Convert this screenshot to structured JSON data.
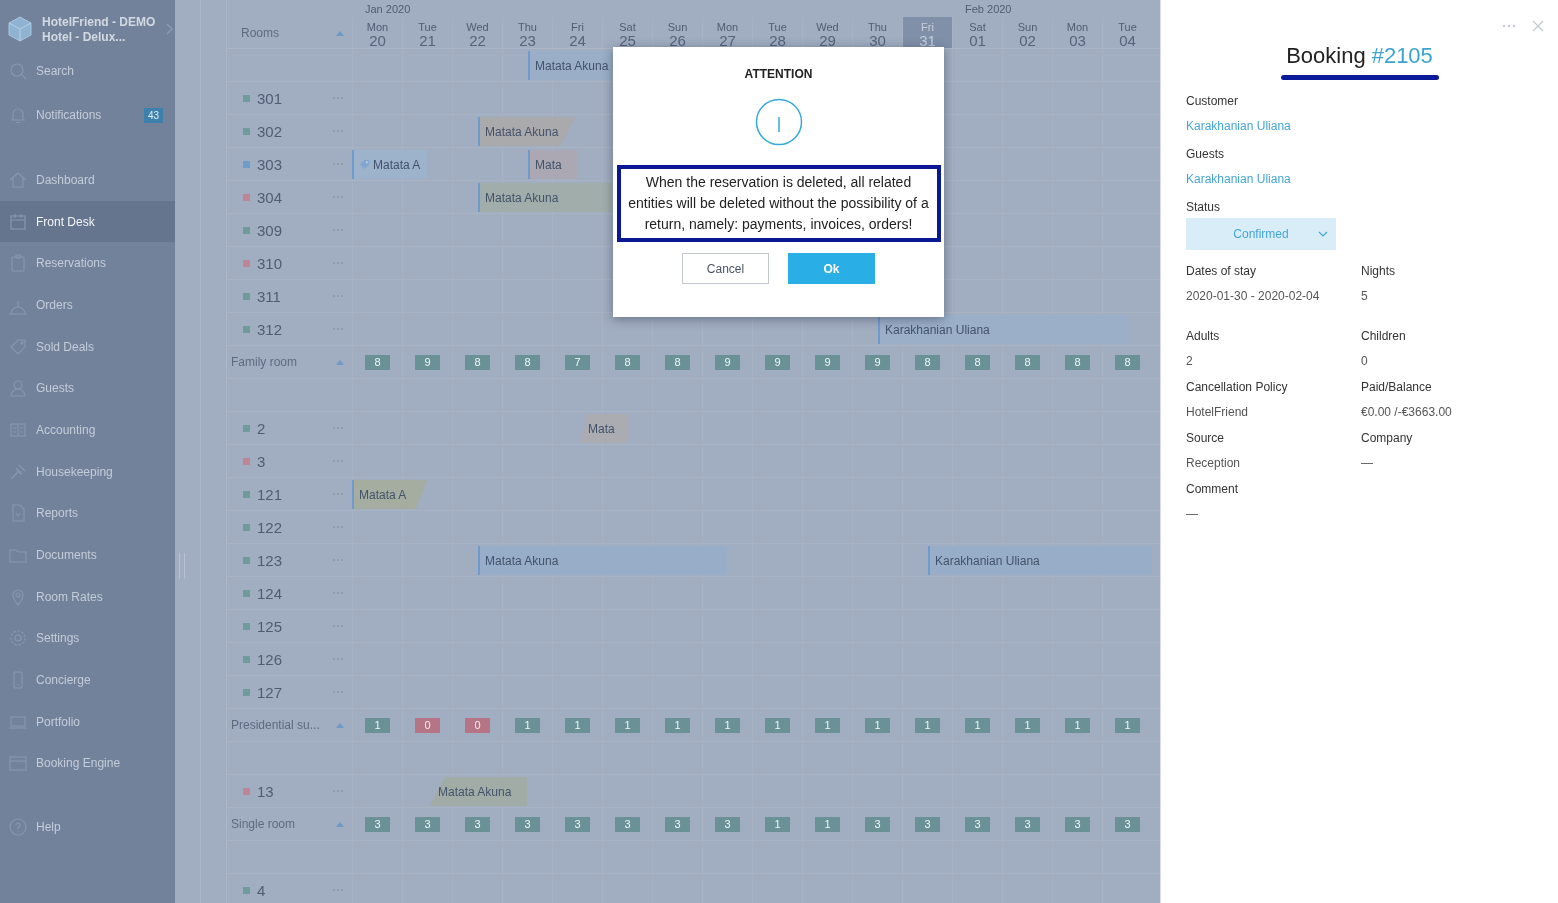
{
  "sidebar": {
    "hotel_name": "HotelFriend - DEMO",
    "hotel_subtitle": "Hotel - Delux...",
    "top_items": [
      {
        "label": "Search",
        "selected": false
      },
      {
        "label": "Notifications",
        "selected": false,
        "badge": "43"
      }
    ],
    "menu_items": [
      {
        "label": "Dashboard",
        "selected": false
      },
      {
        "label": "Front Desk",
        "selected": true
      },
      {
        "label": "Reservations",
        "selected": false
      },
      {
        "label": "Orders",
        "selected": false
      },
      {
        "label": "Sold Deals",
        "selected": false
      },
      {
        "label": "Guests",
        "selected": false
      },
      {
        "label": "Accounting",
        "selected": false
      },
      {
        "label": "Housekeeping",
        "selected": false
      },
      {
        "label": "Reports",
        "selected": false
      },
      {
        "label": "Documents",
        "selected": false
      },
      {
        "label": "Room Rates",
        "selected": false
      },
      {
        "label": "Settings",
        "selected": false
      },
      {
        "label": "Concierge",
        "selected": false
      },
      {
        "label": "Portfolio",
        "selected": false
      },
      {
        "label": "Booking Engine",
        "selected": false
      }
    ],
    "bottom_items": [
      {
        "label": "Help",
        "selected": false
      }
    ]
  },
  "calendar": {
    "rooms_header": "Rooms",
    "months": [
      {
        "label": "Jan 2020"
      },
      {
        "label": "Feb 2020"
      }
    ],
    "days": [
      {
        "name": "Mon",
        "date": "20",
        "today": false
      },
      {
        "name": "Tue",
        "date": "21",
        "today": false
      },
      {
        "name": "Wed",
        "date": "22",
        "today": false
      },
      {
        "name": "Thu",
        "date": "23",
        "today": false
      },
      {
        "name": "Fri",
        "date": "24",
        "today": false
      },
      {
        "name": "Sat",
        "date": "25",
        "today": false
      },
      {
        "name": "Sun",
        "date": "26",
        "today": false
      },
      {
        "name": "Mon",
        "date": "27",
        "today": false
      },
      {
        "name": "Tue",
        "date": "28",
        "today": false
      },
      {
        "name": "Wed",
        "date": "29",
        "today": false
      },
      {
        "name": "Thu",
        "date": "30",
        "today": false
      },
      {
        "name": "Fri",
        "date": "31",
        "today": true
      },
      {
        "name": "Sat",
        "date": "01",
        "today": false
      },
      {
        "name": "Sun",
        "date": "02",
        "today": false
      },
      {
        "name": "Mon",
        "date": "03",
        "today": false
      },
      {
        "name": "Tue",
        "date": "04",
        "today": false
      }
    ],
    "rows": [
      {
        "kind": "unassigned",
        "bookings": [
          {
            "guest": "Matata Akuna",
            "color": "#9aaec7",
            "tagged": false
          }
        ]
      },
      {
        "kind": "room",
        "number": "301",
        "color": "#6d9c9b"
      },
      {
        "kind": "room",
        "number": "302",
        "color": "#6d9c9b",
        "bookings": [
          {
            "guest": "Matata Akuna",
            "color": "#aaa9ab",
            "tagged": false
          }
        ]
      },
      {
        "kind": "room",
        "number": "303",
        "color": "#6f9cc8",
        "bookings": [
          {
            "guest": "Matata A",
            "color": "#9db3cc",
            "tagged": true
          },
          {
            "guest": "Mata",
            "color": "#aba8b3",
            "tagged": false
          }
        ]
      },
      {
        "kind": "room",
        "number": "304",
        "color": "#c08595",
        "bookings": [
          {
            "guest": "Matata Akuna",
            "color": "#a1adab",
            "tagged": false
          }
        ]
      },
      {
        "kind": "room",
        "number": "309",
        "color": "#6d9c9b"
      },
      {
        "kind": "room",
        "number": "310",
        "color": "#c08595"
      },
      {
        "kind": "room",
        "number": "311",
        "color": "#6d9c9b"
      },
      {
        "kind": "room",
        "number": "312",
        "color": "#6d9c9b",
        "bookings": [
          {
            "guest": "Karakhanian Uliana",
            "color": "#9bafc8",
            "tagged": false
          }
        ]
      },
      {
        "kind": "group",
        "name": "Family room",
        "expanded": true,
        "counts": [
          {
            "value": "8",
            "sold_out": false
          },
          {
            "value": "9",
            "sold_out": false
          },
          {
            "value": "8",
            "sold_out": false
          },
          {
            "value": "8",
            "sold_out": false
          },
          {
            "value": "7",
            "sold_out": false
          },
          {
            "value": "8",
            "sold_out": false
          },
          {
            "value": "8",
            "sold_out": false
          },
          {
            "value": "9",
            "sold_out": false
          },
          {
            "value": "9",
            "sold_out": false
          },
          {
            "value": "9",
            "sold_out": false
          },
          {
            "value": "9",
            "sold_out": false
          },
          {
            "value": "8",
            "sold_out": false
          },
          {
            "value": "8",
            "sold_out": false
          },
          {
            "value": "8",
            "sold_out": false
          },
          {
            "value": "8",
            "sold_out": false
          },
          {
            "value": "8",
            "sold_out": false
          }
        ]
      },
      {
        "kind": "spacer"
      },
      {
        "kind": "room",
        "number": "2",
        "color": "#6d9c9b",
        "bookings": [
          {
            "guest": "Mata",
            "color": "#aaacb2",
            "tagged": false
          }
        ]
      },
      {
        "kind": "room",
        "number": "3",
        "color": "#c08595"
      },
      {
        "kind": "room",
        "number": "121",
        "color": "#6d9c9b",
        "bookings": [
          {
            "guest": "Matata A",
            "color": "#a4ada0",
            "tagged": false
          }
        ]
      },
      {
        "kind": "room",
        "number": "122",
        "color": "#6d9c9b"
      },
      {
        "kind": "room",
        "number": "123",
        "color": "#6d9c9b",
        "bookings": [
          {
            "guest": "Matata Akuna",
            "color": "#98adc8",
            "tagged": false
          },
          {
            "guest": "Karakhanian Uliana",
            "color": "#98adc8",
            "tagged": false
          }
        ]
      },
      {
        "kind": "room",
        "number": "124",
        "color": "#6d9c9b"
      },
      {
        "kind": "room",
        "number": "125",
        "color": "#6d9c9b"
      },
      {
        "kind": "room",
        "number": "126",
        "color": "#6d9c9b"
      },
      {
        "kind": "room",
        "number": "127",
        "color": "#6d9c9b"
      },
      {
        "kind": "group",
        "name": "Presidential su...",
        "expanded": true,
        "counts": [
          {
            "value": "1",
            "sold_out": false
          },
          {
            "value": "0",
            "sold_out": true
          },
          {
            "value": "0",
            "sold_out": true
          },
          {
            "value": "1",
            "sold_out": false
          },
          {
            "value": "1",
            "sold_out": false
          },
          {
            "value": "1",
            "sold_out": false
          },
          {
            "value": "1",
            "sold_out": false
          },
          {
            "value": "1",
            "sold_out": false
          },
          {
            "value": "1",
            "sold_out": false
          },
          {
            "value": "1",
            "sold_out": false
          },
          {
            "value": "1",
            "sold_out": false
          },
          {
            "value": "1",
            "sold_out": false
          },
          {
            "value": "1",
            "sold_out": false
          },
          {
            "value": "1",
            "sold_out": false
          },
          {
            "value": "1",
            "sold_out": false
          },
          {
            "value": "1",
            "sold_out": false
          }
        ]
      },
      {
        "kind": "spacer"
      },
      {
        "kind": "room",
        "number": "13",
        "color": "#c08595",
        "bookings": [
          {
            "guest": "Matata Akuna",
            "color": "#a2aca6",
            "tagged": false
          }
        ]
      },
      {
        "kind": "group",
        "name": "Single room",
        "expanded": true,
        "counts": [
          {
            "value": "3",
            "sold_out": false
          },
          {
            "value": "3",
            "sold_out": false
          },
          {
            "value": "3",
            "sold_out": false
          },
          {
            "value": "3",
            "sold_out": false
          },
          {
            "value": "3",
            "sold_out": false
          },
          {
            "value": "3",
            "sold_out": false
          },
          {
            "value": "3",
            "sold_out": false
          },
          {
            "value": "3",
            "sold_out": false
          },
          {
            "value": "1",
            "sold_out": false
          },
          {
            "value": "1",
            "sold_out": false
          },
          {
            "value": "3",
            "sold_out": false
          },
          {
            "value": "3",
            "sold_out": false
          },
          {
            "value": "3",
            "sold_out": false
          },
          {
            "value": "3",
            "sold_out": false
          },
          {
            "value": "3",
            "sold_out": false
          },
          {
            "value": "3",
            "sold_out": false
          }
        ]
      },
      {
        "kind": "spacer"
      },
      {
        "kind": "room",
        "number": "4",
        "color": "#6d9c9b"
      }
    ]
  },
  "dialog": {
    "title": "ATTENTION",
    "message": "When the reservation is deleted, all related entities will be deleted without the possibility of a return, namely: payments, invoices, orders!",
    "buttons": [
      {
        "label": "Cancel",
        "kind": "secondary"
      },
      {
        "label": "Ok",
        "kind": "primary"
      }
    ]
  },
  "booking_panel": {
    "title": "Booking",
    "number": "#2105",
    "rows": [
      [
        {
          "label": "Customer",
          "value": "Karakhanian Uliana",
          "kind": "link"
        }
      ],
      [
        {
          "label": "Guests",
          "value": "Karakhanian Uliana",
          "kind": "link"
        }
      ],
      [
        {
          "label": "Status",
          "value": "Confirmed",
          "kind": "select"
        }
      ],
      [
        {
          "label": "Dates of stay",
          "value": "2020-01-30 - 2020-02-04",
          "kind": "text"
        },
        {
          "label": "Nights",
          "value": "5",
          "kind": "text"
        }
      ],
      [
        {
          "label": "Adults",
          "value": "2",
          "kind": "text"
        },
        {
          "label": "Children",
          "value": "0",
          "kind": "text"
        }
      ],
      [
        {
          "label": "Cancellation Policy",
          "value": "HotelFriend",
          "kind": "text"
        },
        {
          "label": "Paid/Balance",
          "value": "€0.00 /-€3663.00",
          "kind": "text"
        }
      ],
      [
        {
          "label": "Source",
          "value": "Reception",
          "kind": "text"
        },
        {
          "label": "Company",
          "value": "—",
          "kind": "text"
        }
      ],
      [
        {
          "label": "Comment",
          "value": "—",
          "kind": "text"
        }
      ]
    ]
  }
}
